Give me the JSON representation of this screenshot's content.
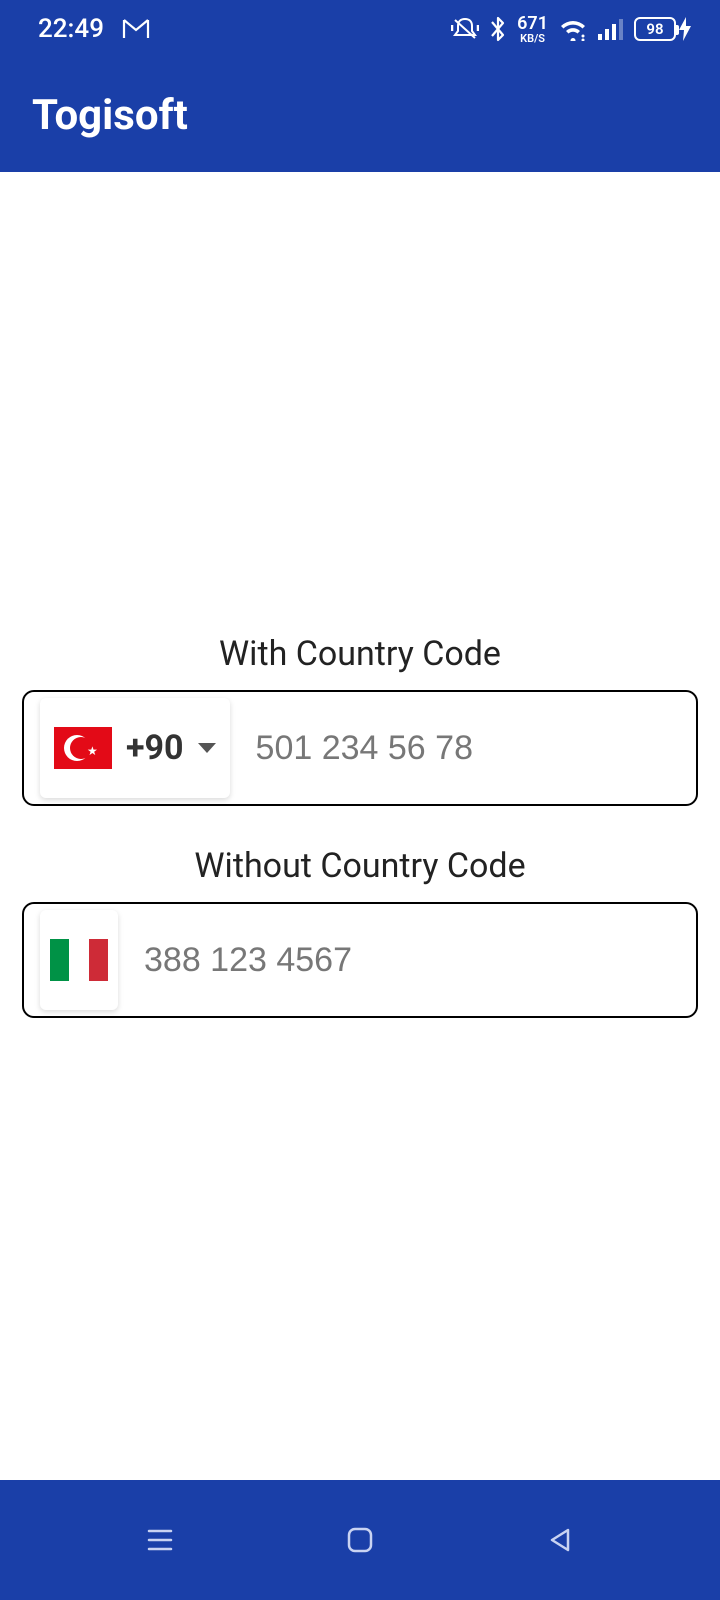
{
  "status": {
    "time": "22:49",
    "net_speed": "671",
    "net_unit": "KB/S",
    "battery": "98"
  },
  "appbar": {
    "title": "Togisoft"
  },
  "section1": {
    "label": "With Country Code",
    "dial_code": "+90",
    "placeholder": "501 234 56 78"
  },
  "section2": {
    "label": "Without Country Code",
    "placeholder": "388 123 4567"
  }
}
